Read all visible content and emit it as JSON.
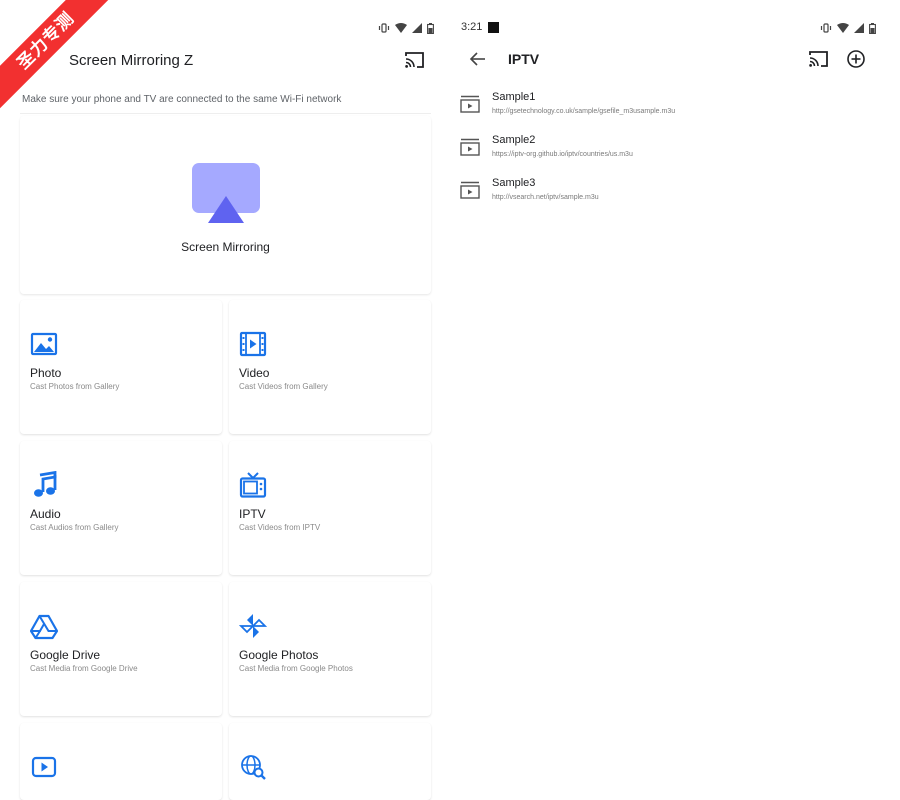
{
  "watermark": {
    "text": "圣力专测"
  },
  "left_screen": {
    "app_title": "Screen Mirroring Z",
    "wifi_note": "Make sure your phone and TV are connected to the same Wi-Fi network",
    "mirroring": {
      "label": "Screen Mirroring",
      "icon": "airplay-icon"
    },
    "grid": [
      {
        "title": "Photo",
        "subtitle": "Cast Photos from Gallery",
        "icon": "image-icon"
      },
      {
        "title": "Video",
        "subtitle": "Cast Videos from Gallery",
        "icon": "film-icon"
      },
      {
        "title": "Audio",
        "subtitle": "Cast Audios from Gallery",
        "icon": "music-note-icon"
      },
      {
        "title": "IPTV",
        "subtitle": "Cast Videos from IPTV",
        "icon": "tv-icon"
      },
      {
        "title": "Google Drive",
        "subtitle": "Cast Media from Google Drive",
        "icon": "drive-icon"
      },
      {
        "title": "Google Photos",
        "subtitle": "Cast Media from Google Photos",
        "icon": "pinwheel-icon"
      },
      {
        "title": "",
        "subtitle": "",
        "icon": "youtube-icon"
      },
      {
        "title": "",
        "subtitle": "",
        "icon": "web-search-icon"
      }
    ]
  },
  "right_screen": {
    "time": "3:21",
    "title": "IPTV",
    "items": [
      {
        "name": "Sample1",
        "url": "http://gsetechnology.co.uk/sample/gsefile_m3usample.m3u"
      },
      {
        "name": "Sample2",
        "url": "https://iptv-org.github.io/iptv/countries/us.m3u"
      },
      {
        "name": "Sample3",
        "url": "http://vsearch.net/iptv/sample.m3u"
      }
    ]
  },
  "colors": {
    "accent": "#1a73e8",
    "mirror_bg": "#a5a9ff",
    "mirror_tri": "#5f63f0"
  }
}
